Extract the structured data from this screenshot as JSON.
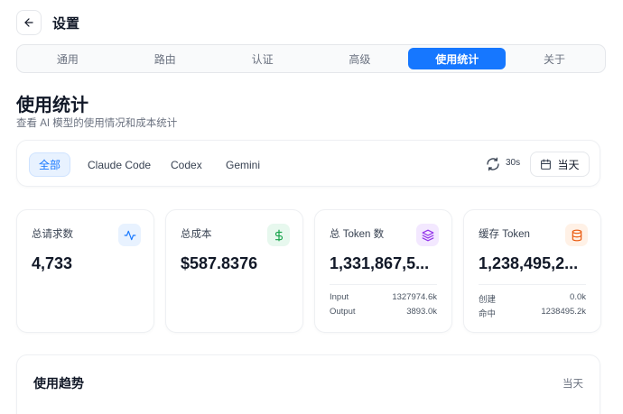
{
  "header": {
    "title": "设置"
  },
  "tabs": [
    {
      "label": "通用"
    },
    {
      "label": "路由"
    },
    {
      "label": "认证"
    },
    {
      "label": "高级"
    },
    {
      "label": "使用统计",
      "active": true
    },
    {
      "label": "关于"
    }
  ],
  "main": {
    "title": "使用统计",
    "subtitle": "查看 AI 模型的使用情况和成本统计"
  },
  "filters": {
    "chips": [
      "全部",
      "Claude Code",
      "Codex",
      "Gemini"
    ],
    "refresh_interval": "30s",
    "date_range": "当天"
  },
  "cards": [
    {
      "label": "总请求数",
      "value": "4,733",
      "icon": "activity-icon",
      "color": "#1677ff"
    },
    {
      "label": "总成本",
      "value": "$587.8376",
      "icon": "dollar-icon",
      "color": "#16a34a"
    },
    {
      "label": "总 Token 数",
      "value": "1,331,867,5...",
      "icon": "layers-icon",
      "color": "#9333ea",
      "rows": [
        {
          "k": "Input",
          "v": "1327974.6k"
        },
        {
          "k": "Output",
          "v": "3893.0k"
        }
      ]
    },
    {
      "label": "缓存 Token",
      "value": "1,238,495,2...",
      "icon": "database-icon",
      "color": "#ea580c",
      "rows": [
        {
          "k": "创建",
          "v": "0.0k"
        },
        {
          "k": "命中",
          "v": "1238495.2k"
        }
      ]
    }
  ],
  "trend": {
    "title": "使用趋势",
    "range": "当天"
  }
}
